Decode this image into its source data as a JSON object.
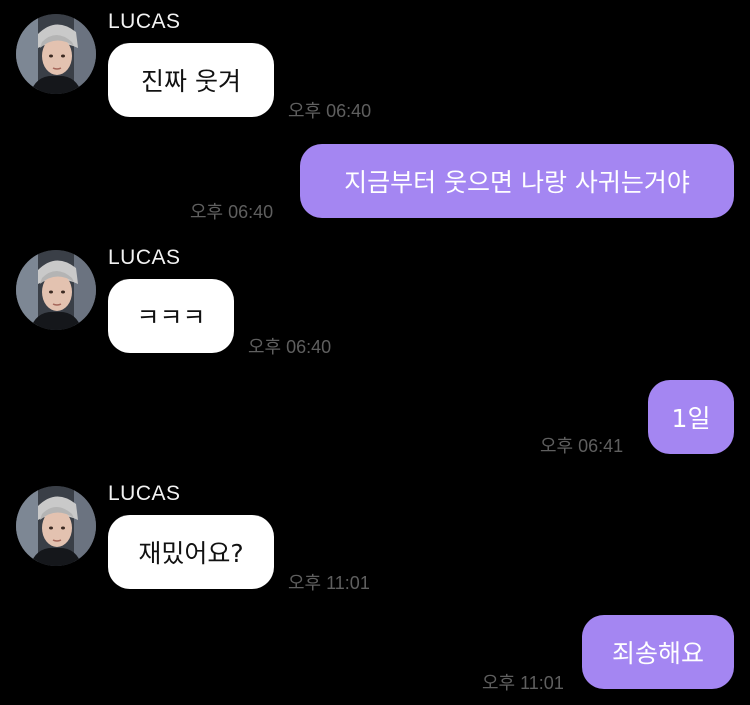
{
  "chat": {
    "messages": [
      {
        "sender": "LUCAS",
        "text": "진짜 웃겨",
        "time": "오후 06:40"
      },
      {
        "text": "지금부터 웃으면 나랑 사귀는거야",
        "time": "오후 06:40"
      },
      {
        "sender": "LUCAS",
        "text": "ㅋㅋㅋ",
        "time": "오후 06:40"
      },
      {
        "text": "1일",
        "time": "오후 06:41"
      },
      {
        "sender": "LUCAS",
        "text": "재밌어요?",
        "time": "오후 11:01"
      },
      {
        "text": "죄송해요",
        "time": "오후 11:01"
      }
    ]
  },
  "colors": {
    "background": "#000000",
    "incoming_bubble": "#ffffff",
    "outgoing_bubble": "#a486f2",
    "timestamp": "#5f5f5f"
  },
  "icons": {
    "avatar": "profile-photo"
  }
}
